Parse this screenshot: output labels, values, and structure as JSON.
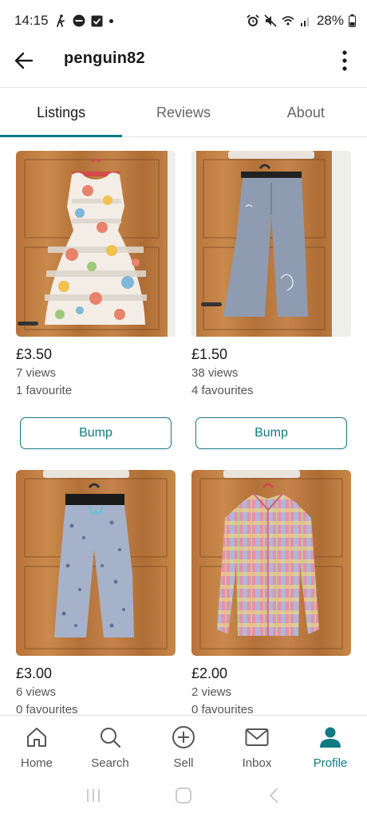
{
  "status_bar": {
    "time": "14:15",
    "battery": "28%",
    "left_icons": [
      "walking-icon",
      "minus-circle-icon",
      "checkbox-icon",
      "dot-icon"
    ],
    "right_icons": [
      "alarm-icon",
      "mute-icon",
      "wifi-icon",
      "signal-icon",
      "battery-icon"
    ]
  },
  "header": {
    "title": "penguin82",
    "back_icon": "back-arrow-icon",
    "menu_icon": "more-vertical-icon"
  },
  "tabs": [
    {
      "label": "Listings",
      "active": true
    },
    {
      "label": "Reviews",
      "active": false
    },
    {
      "label": "About",
      "active": false
    }
  ],
  "listings": [
    {
      "price": "£3.50",
      "views": "7 views",
      "favourites": "1 favourite",
      "bump_label": "Bump",
      "item": "floral dress"
    },
    {
      "price": "£1.50",
      "views": "38 views",
      "favourites": "4 favourites",
      "bump_label": "Bump",
      "item": "grey wide trousers"
    },
    {
      "price": "£3.00",
      "views": "6 views",
      "favourites": "0 favourites",
      "item": "floral cropped trousers"
    },
    {
      "price": "£2.00",
      "views": "2 views",
      "favourites": "0 favourites",
      "item": "pink check shirt"
    }
  ],
  "bottom_nav": [
    {
      "label": "Home",
      "icon": "home-icon",
      "active": false
    },
    {
      "label": "Search",
      "icon": "search-icon",
      "active": false
    },
    {
      "label": "Sell",
      "icon": "plus-circle-icon",
      "active": false
    },
    {
      "label": "Inbox",
      "icon": "mail-icon",
      "active": false
    },
    {
      "label": "Profile",
      "icon": "person-icon",
      "active": true
    }
  ],
  "colors": {
    "accent": "#0f7a82",
    "divider": "#e2e2e2",
    "text_primary": "#1a1a1a",
    "text_secondary": "#555555"
  }
}
